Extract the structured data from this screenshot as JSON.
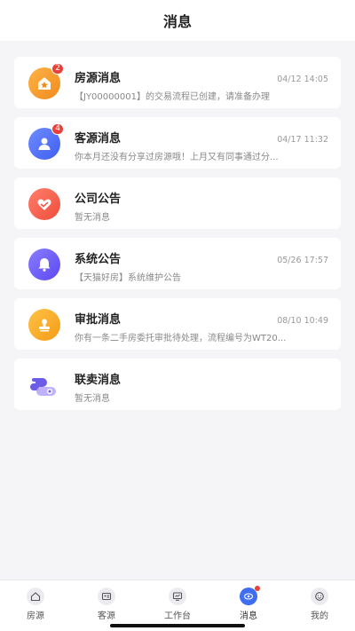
{
  "header": {
    "title": "消息"
  },
  "messages": [
    {
      "title": "房源消息",
      "time": "04/12 14:05",
      "subtitle": "【JY00000001】的交易流程已创建，请准备办理",
      "badge": "2"
    },
    {
      "title": "客源消息",
      "time": "04/17 11:32",
      "subtitle": "你本月还没有分享过房源哦！上月又有同事通过分...",
      "badge": "4"
    },
    {
      "title": "公司公告",
      "time": "",
      "subtitle": "暂无消息",
      "badge": ""
    },
    {
      "title": "系统公告",
      "time": "05/26 17:57",
      "subtitle": "【天猫好房】系统维护公告",
      "badge": ""
    },
    {
      "title": "审批消息",
      "time": "08/10 10:49",
      "subtitle": "你有一条二手房委托审批待处理，流程编号为WT20...",
      "badge": ""
    },
    {
      "title": "联卖消息",
      "time": "",
      "subtitle": "暂无消息",
      "badge": ""
    }
  ],
  "tabs": [
    {
      "label": "房源",
      "icon": "house-icon"
    },
    {
      "label": "客源",
      "icon": "id-card-icon"
    },
    {
      "label": "工作台",
      "icon": "monitor-icon"
    },
    {
      "label": "消息",
      "icon": "message-eye-icon",
      "active": true
    },
    {
      "label": "我的",
      "icon": "smile-icon"
    }
  ],
  "colors": {
    "accent": "#3f6ef0",
    "badge": "#e8413a"
  }
}
